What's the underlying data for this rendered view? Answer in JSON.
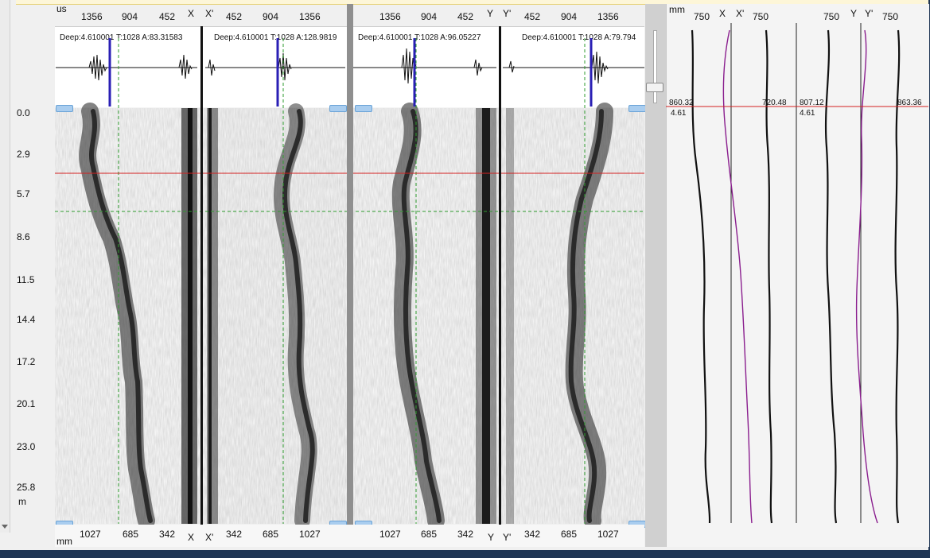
{
  "top_axis": {
    "unit": "us",
    "x_ticks": [
      "1356",
      "904",
      "452"
    ],
    "xp_ticks": [
      "452",
      "904",
      "1356"
    ],
    "y_ticks": [
      "1356",
      "904",
      "452"
    ],
    "yp_ticks": [
      "452",
      "904",
      "1356"
    ]
  },
  "bottom_axis": {
    "unit": "mm",
    "x_ticks": [
      "1027",
      "685",
      "342"
    ],
    "xp_ticks": [
      "342",
      "685",
      "1027"
    ],
    "y_ticks": [
      "1027",
      "685",
      "342"
    ],
    "yp_ticks": [
      "342",
      "685",
      "1027"
    ]
  },
  "channels": {
    "x": "X",
    "xp": "X'",
    "y": "Y",
    "yp": "Y'"
  },
  "waveforms": {
    "x": "Deep:4.610001 T:1028 A:83.31583",
    "xp": "Deep:4.610001 T:1028 A:128.9819",
    "y": "Deep:4.610001 T:1028 A:96.05227",
    "yp": "Deep:4.610001 T:1028 A:79.794"
  },
  "depth_axis": {
    "unit": "m",
    "ticks": [
      "0.0",
      "2.9",
      "5.7",
      "8.6",
      "11.5",
      "14.4",
      "17.2",
      "20.1",
      "23.0",
      "25.8"
    ]
  },
  "profile_panel": {
    "unit": "mm",
    "scale_values": [
      "750",
      "750",
      "750",
      "750"
    ],
    "readouts": {
      "x": "860.32",
      "xp": "720.48",
      "y": "807.12",
      "yp": "863.36",
      "depth_left": "4.61",
      "depth_right": "4.61"
    }
  },
  "colors": {
    "cursor_line": "#d42020",
    "dashed_guide": "#2e9b2e",
    "time_marker": "#2a1fb5",
    "profile_secondary": "#8a1e8e",
    "window_frame": "#1f3554",
    "panel_bg": "#f4f4f4"
  }
}
